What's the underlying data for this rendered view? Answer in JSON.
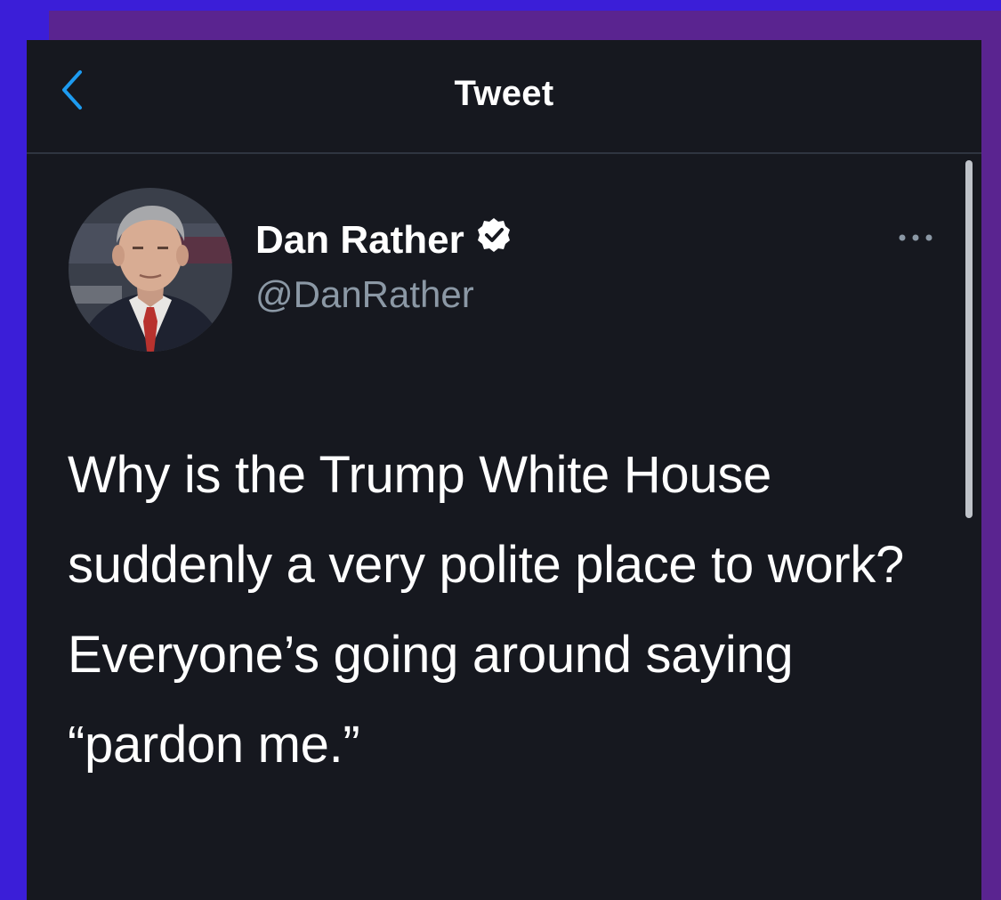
{
  "header": {
    "title": "Tweet",
    "back_icon": "chevron-left-icon"
  },
  "tweet": {
    "author": {
      "display_name": "Dan Rather",
      "handle": "@DanRather",
      "verified_icon": "verified-badge-icon"
    },
    "more_icon": "more-horizontal-icon",
    "text": "Why is the Trump White House suddenly a very polite place to work? Everyone’s going around saying “pardon me.”"
  },
  "colors": {
    "background": "#16181f",
    "accent": "#1d9bf0",
    "text_primary": "#ffffff",
    "text_secondary": "#8b98a5",
    "outer_blue": "#3b1ed8",
    "outer_purple": "#5a2490"
  }
}
